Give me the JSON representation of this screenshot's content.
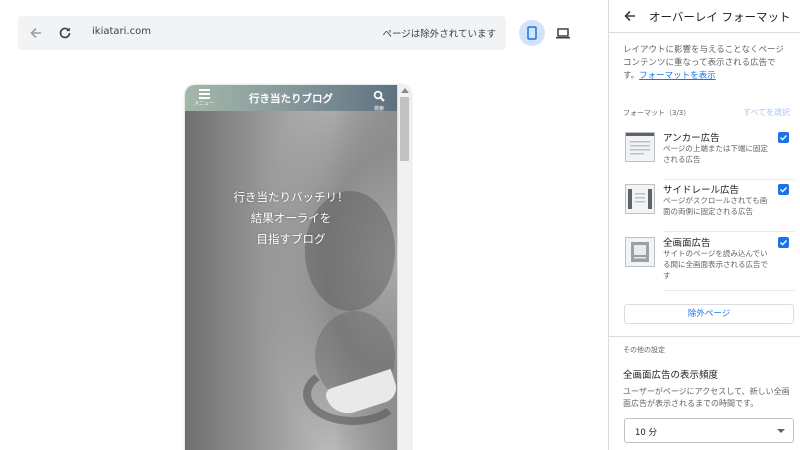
{
  "toolbar": {
    "url": "ikiatari.com",
    "page_status": "ページは除外されています"
  },
  "phone": {
    "menu_label": "メニュー",
    "blog_title": "行き当たりブログ",
    "search_label": "検索",
    "hero_lines": [
      "行き当たりバッチリ！",
      "結果オーライを",
      "目指すブログ"
    ]
  },
  "panel": {
    "title": "オーバーレイ フォーマット",
    "description": "レイアウトに影響を与えることなくページ コンテンツに重なって表示される広告です。",
    "description_link": "フォーマットを表示",
    "format_count": "フォーマット（3/3）",
    "select_all": "すべてを選択",
    "formats": [
      {
        "name": "アンカー広告",
        "description": "ページの上端または下端に固定される広告",
        "checked": true,
        "icon": "anchor-ad-icon"
      },
      {
        "name": "サイドレール広告",
        "description": "ページがスクロールされても画面の両側に固定される広告",
        "checked": true,
        "icon": "side-rail-ad-icon"
      },
      {
        "name": "全画面広告",
        "description": "サイトのページを読み込んでいる間に全画面表示される広告です",
        "checked": true,
        "icon": "vignette-ad-icon"
      }
    ],
    "exclude_pages_button": "除外ページ",
    "other_settings": "その他の設定",
    "frequency_title": "全画面広告の表示頻度",
    "frequency_description": "ユーザーがページにアクセスして、新しい全画面広告が表示されるまでの時間です。",
    "frequency_value": "10 分"
  },
  "colors": {
    "accent": "#1a73e8",
    "device_selected_bg": "#d2e3fc",
    "toolbar_bg": "#f1f3f4"
  }
}
